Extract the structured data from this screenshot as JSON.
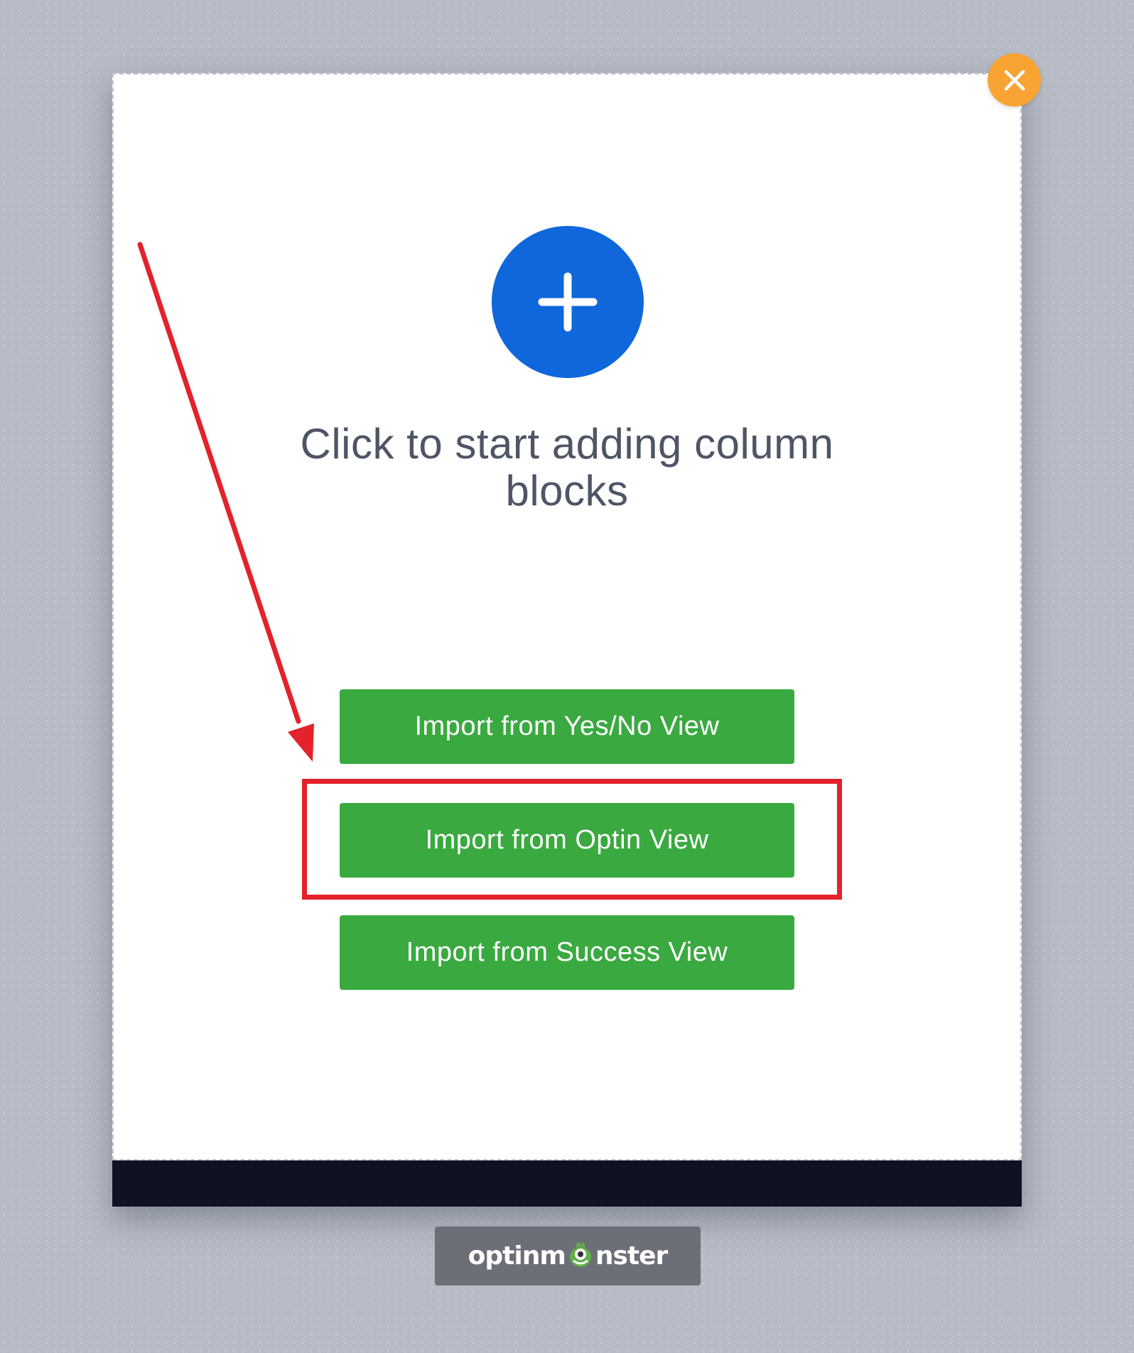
{
  "close_button": {
    "icon": "close-icon",
    "color": "#f9a432"
  },
  "add_block": {
    "icon": "plus-icon",
    "color": "#0f67db",
    "prompt": "Click to start adding column blocks"
  },
  "import_buttons": [
    {
      "label": "Import from Yes/No View"
    },
    {
      "label": "Import from Optin View"
    },
    {
      "label": "Import from Success View"
    }
  ],
  "annotation": {
    "highlight_color": "#e3222b",
    "highlighted_button": "Import from Optin View"
  },
  "branding": {
    "text_prefix": "optinm",
    "text_suffix": "nster",
    "logo_icon": "monster-icon"
  },
  "colors": {
    "button_green": "#3aa940",
    "footer_bar": "#0f1221",
    "background": "#b6bbc6"
  }
}
